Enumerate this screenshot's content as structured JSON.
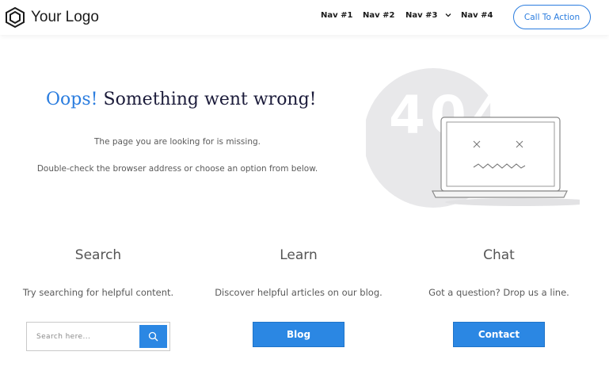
{
  "header": {
    "logo_text": "Your Logo",
    "nav": [
      "Nav #1",
      "Nav #2",
      "Nav #3",
      "Nav #4"
    ],
    "cta_label": "Call To Action"
  },
  "hero": {
    "headline_accent": "Oops!",
    "headline_rest": "Something went wrong!",
    "line1": "The page you are looking for is missing.",
    "line2": "Double-check the browser address or choose an option from below.",
    "illustration_text": "404"
  },
  "columns": [
    {
      "title": "Search",
      "text": "Try searching for helpful content.",
      "placeholder": "Search here..."
    },
    {
      "title": "Learn",
      "text": "Discover helpful articles on our blog.",
      "button": "Blog"
    },
    {
      "title": "Chat",
      "text": "Got a question? Drop us a line.",
      "button": "Contact"
    }
  ],
  "colors": {
    "accent": "#2b7ddf",
    "button": "#2b87e3",
    "heading": "#1b1b3a"
  }
}
